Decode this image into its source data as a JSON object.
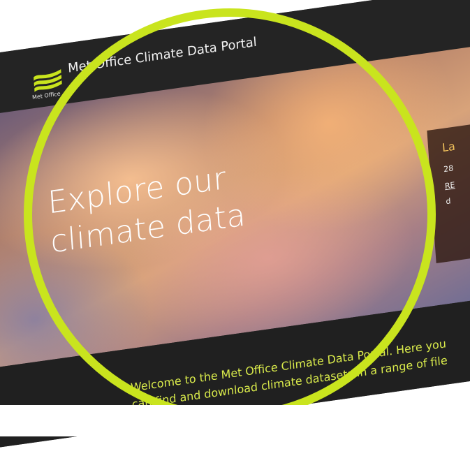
{
  "header": {
    "logo_caption": "Met Office",
    "site_title": "Met Office Climate Data Portal"
  },
  "hero": {
    "title_line1": "Explore our",
    "title_line2": "climate data"
  },
  "latest": {
    "heading": "La",
    "lines": [
      "28",
      "RE",
      "d"
    ]
  },
  "intro": {
    "text": "Welcome to the Met Office Climate Data Portal. Here you can find and download climate datasets in a range of file"
  },
  "colors": {
    "ring": "#c9e41e",
    "accent_text": "#d9ea4b",
    "latest_heading": "#f3c35c",
    "dark": "#242424"
  },
  "icons": {
    "logo": "met-office-logo-icon"
  }
}
